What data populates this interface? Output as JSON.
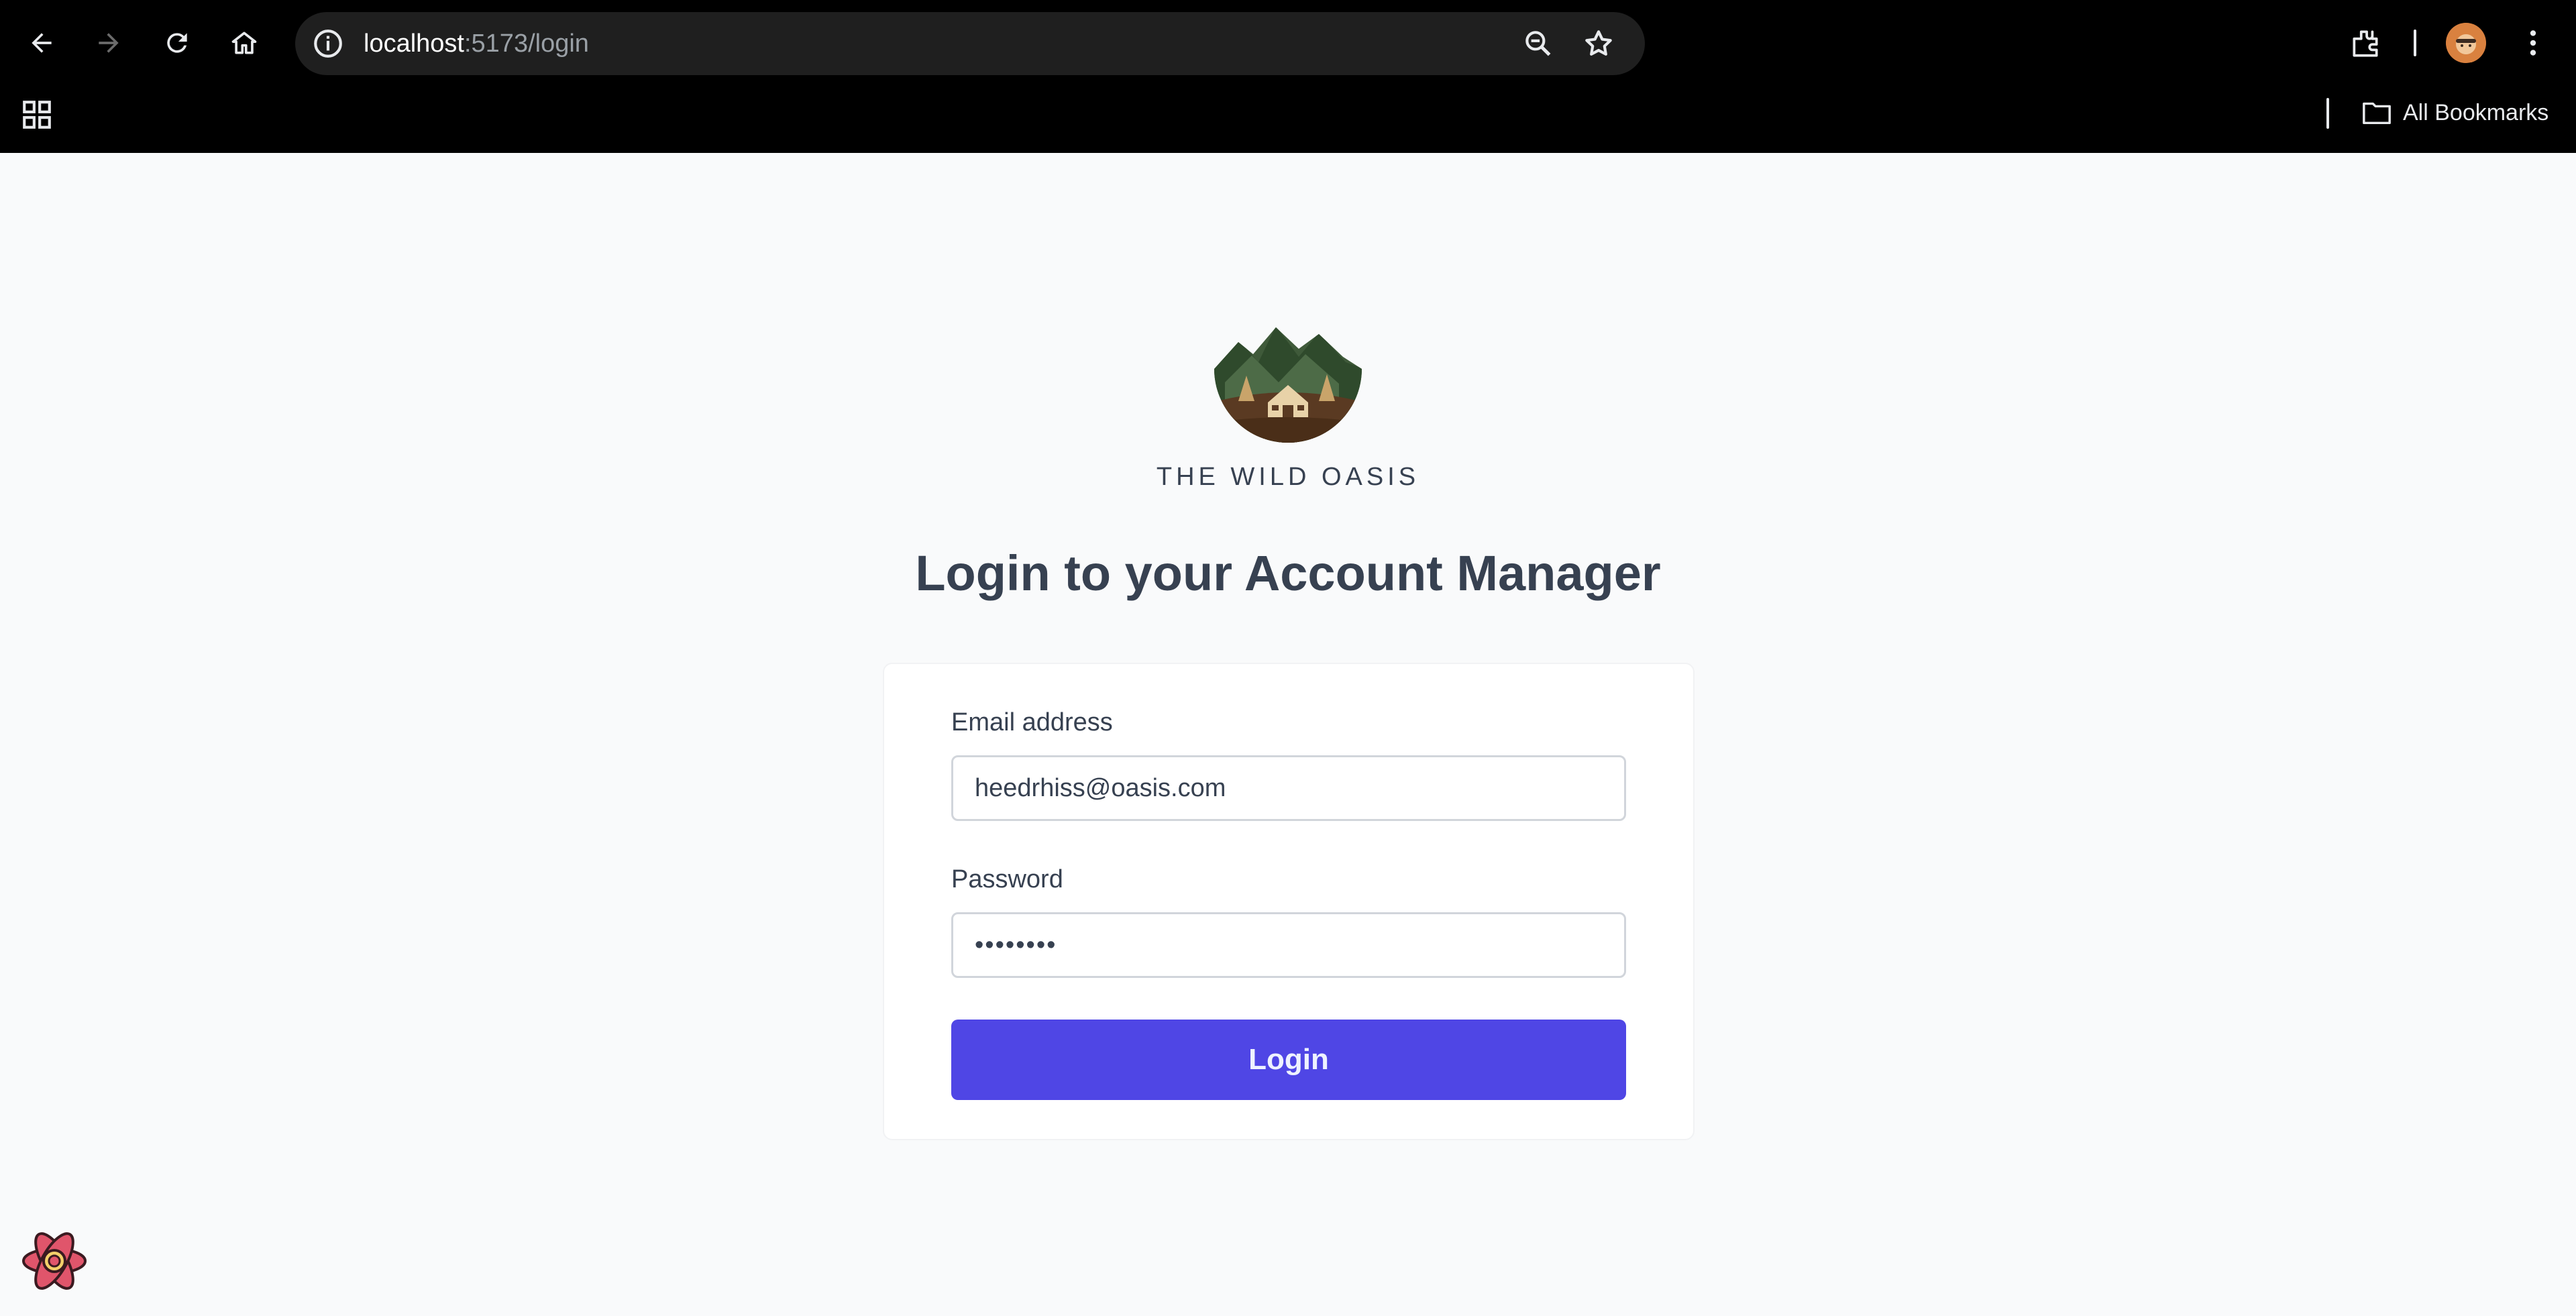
{
  "browser": {
    "url_host": "localhost",
    "url_path": ":5173/login",
    "all_bookmarks_label": "All Bookmarks",
    "icons": [
      "back-icon",
      "forward-icon",
      "reload-icon",
      "home-icon",
      "site-info-icon",
      "zoom-icon",
      "bookmark-star-icon",
      "extensions-icon",
      "profile-avatar",
      "menu-icon",
      "apps-grid-icon",
      "folder-icon"
    ]
  },
  "page": {
    "brand": "THE WILD OASIS",
    "heading": "Login to your Account Manager",
    "form": {
      "email_label": "Email address",
      "email_value": "heedrhiss@oasis.com",
      "password_label": "Password",
      "password_value": "••••••••",
      "submit_label": "Login"
    }
  },
  "colors": {
    "accent": "#4f46e5",
    "page_bg": "#f9fafb",
    "text": "#374151"
  }
}
